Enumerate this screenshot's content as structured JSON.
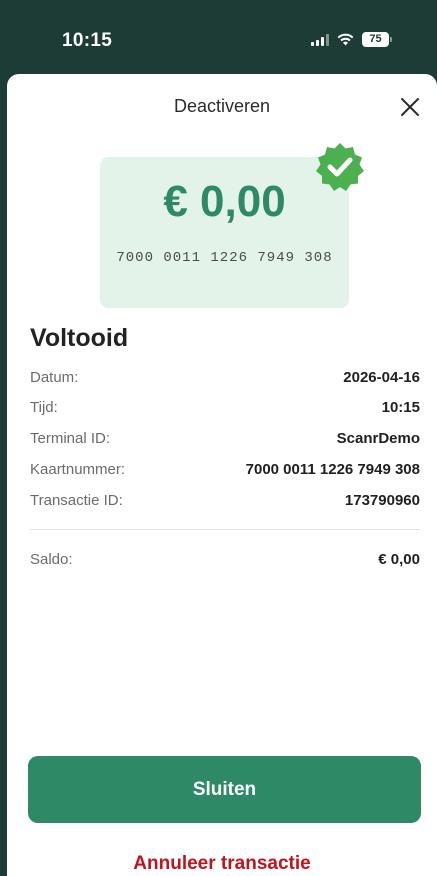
{
  "status_bar": {
    "time": "10:15",
    "battery": "75",
    "icons": [
      "signal-icon",
      "wifi-icon",
      "battery-icon"
    ]
  },
  "sheet": {
    "title": "Deactiveren",
    "close_icon": "close-icon"
  },
  "card": {
    "amount": "€ 0,00",
    "number": "7000 0011 1226 7949 308",
    "badge_icon": "check-badge-icon"
  },
  "result": {
    "heading": "Voltooid",
    "rows": [
      {
        "label": "Datum:",
        "value": "2026-04-16"
      },
      {
        "label": "Tijd:",
        "value": "10:15"
      },
      {
        "label": "Terminal ID:",
        "value": "ScanrDemo"
      },
      {
        "label": "Kaartnummer:",
        "value": "7000 0011 1226 7949 308"
      },
      {
        "label": "Transactie ID:",
        "value": "173790960"
      }
    ],
    "balance": {
      "label": "Saldo:",
      "value": "€ 0,00"
    }
  },
  "actions": {
    "close_label": "Sluiten",
    "cancel_label": "Annuleer transactie"
  },
  "colors": {
    "header_bg": "#1d3c36",
    "accent": "#2e8966",
    "card_bg": "#e4f3ea",
    "danger": "#c0141c"
  }
}
